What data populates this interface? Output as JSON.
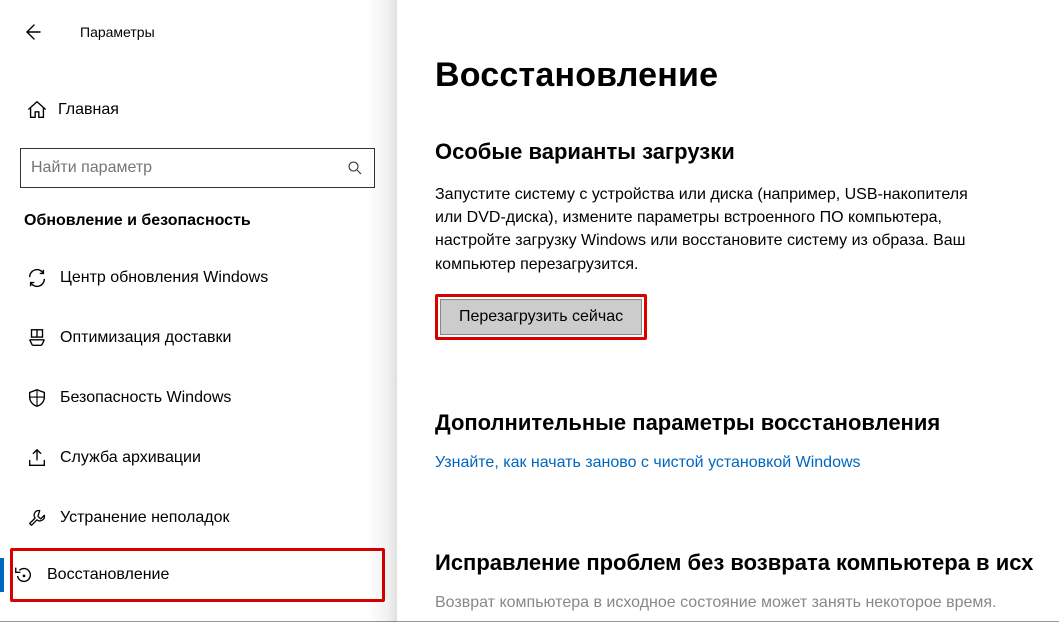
{
  "header": {
    "title": "Параметры"
  },
  "sidebar": {
    "home": "Главная",
    "search_placeholder": "Найти параметр",
    "section": "Обновление и безопасность",
    "items": [
      {
        "label": "Центр обновления Windows"
      },
      {
        "label": "Оптимизация доставки"
      },
      {
        "label": "Безопасность Windows"
      },
      {
        "label": "Служба архивации"
      },
      {
        "label": "Устранение неполадок"
      },
      {
        "label": "Восстановление"
      }
    ]
  },
  "content": {
    "page_title": "Восстановление",
    "section1": {
      "heading": "Особые варианты загрузки",
      "text": "Запустите систему с устройства или диска (например, USB-накопителя или DVD-диска), измените параметры встроенного ПО компьютера, настройте загрузку Windows или восстановите систему из образа. Ваш компьютер перезагрузится.",
      "button": "Перезагрузить сейчас"
    },
    "section2": {
      "heading": "Дополнительные параметры восстановления",
      "link": "Узнайте, как начать заново с чистой установкой Windows"
    },
    "section3": {
      "heading": "Исправление проблем без возврата компьютера в исх",
      "text": "Возврат компьютера в исходное состояние может занять некоторое время."
    }
  }
}
